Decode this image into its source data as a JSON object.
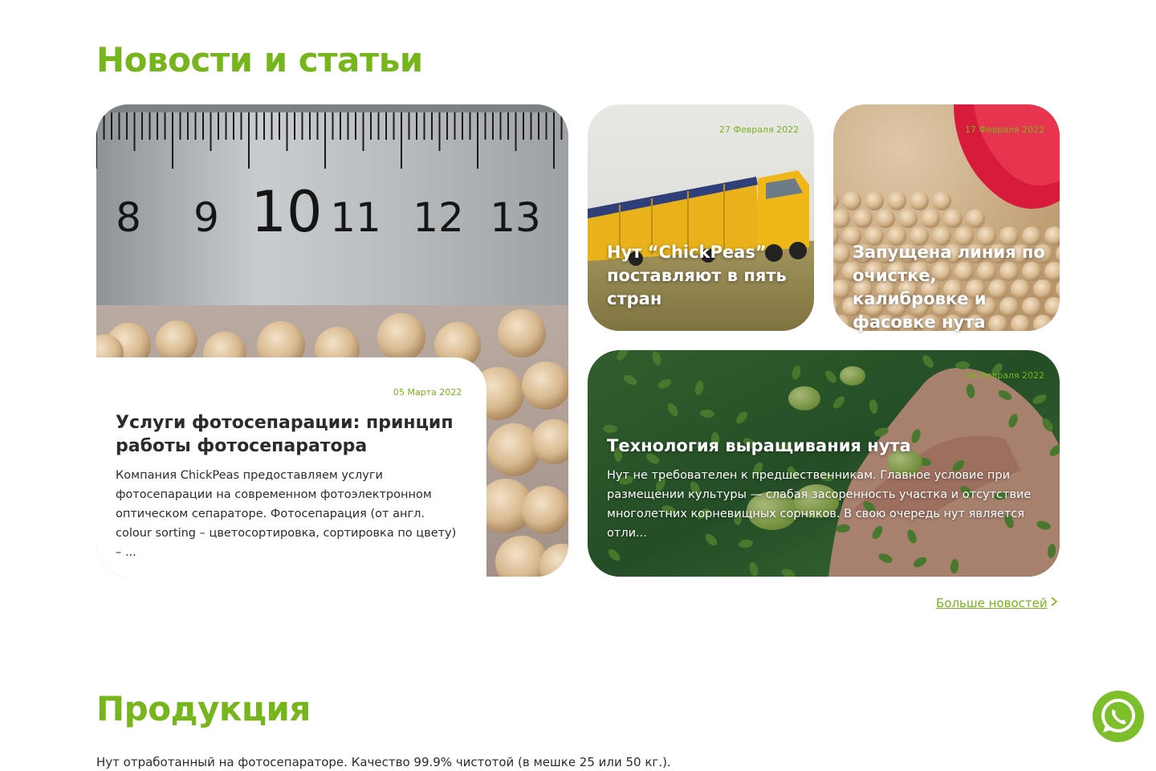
{
  "news": {
    "title": "Новости и статьи",
    "more_link": "Больше новостей",
    "articles": [
      {
        "date": "05 Марта 2022",
        "title": "Услуги фотосепарации: принцип работы фотосепаратора",
        "excerpt": "Компания ChickPeas предоставляем услуги фотосепарации на современном фотоэлектронном оптическом сепараторе. Фотосепарация (от англ. colour sorting – цветосортировка, сортировка по цвету) – ...",
        "ruler_numbers": [
          "8",
          "9",
          "10",
          "11",
          "12",
          "13"
        ]
      },
      {
        "date": "27 Февраля 2022",
        "title": "Нут “ChickPeas” поставляют в пять стран"
      },
      {
        "date": "17 Февраля 2022",
        "title": "Запущена линия по очистке, калибровке и фасовке нута"
      },
      {
        "date": "04 Февраля 2022",
        "title": "Технология выращивания нута",
        "excerpt": "Нут не требовател­ен к предшественникам. Главное условие при размещении культуры — слабая засоренность участка и отсутствие многолетних корневищных сорняков. В свою очередь нут является отли..."
      }
    ]
  },
  "products": {
    "title": "Продукция",
    "text": "Нут отработанный на фотосепараторе. Качество 99.9% чистотой (в мешке 25 или 50 кг.)."
  },
  "colors": {
    "accent": "#77b51c",
    "whatsapp": "#7cbf2a"
  },
  "icons": {
    "more": "chevron-right-icon",
    "chat": "whatsapp-icon"
  }
}
